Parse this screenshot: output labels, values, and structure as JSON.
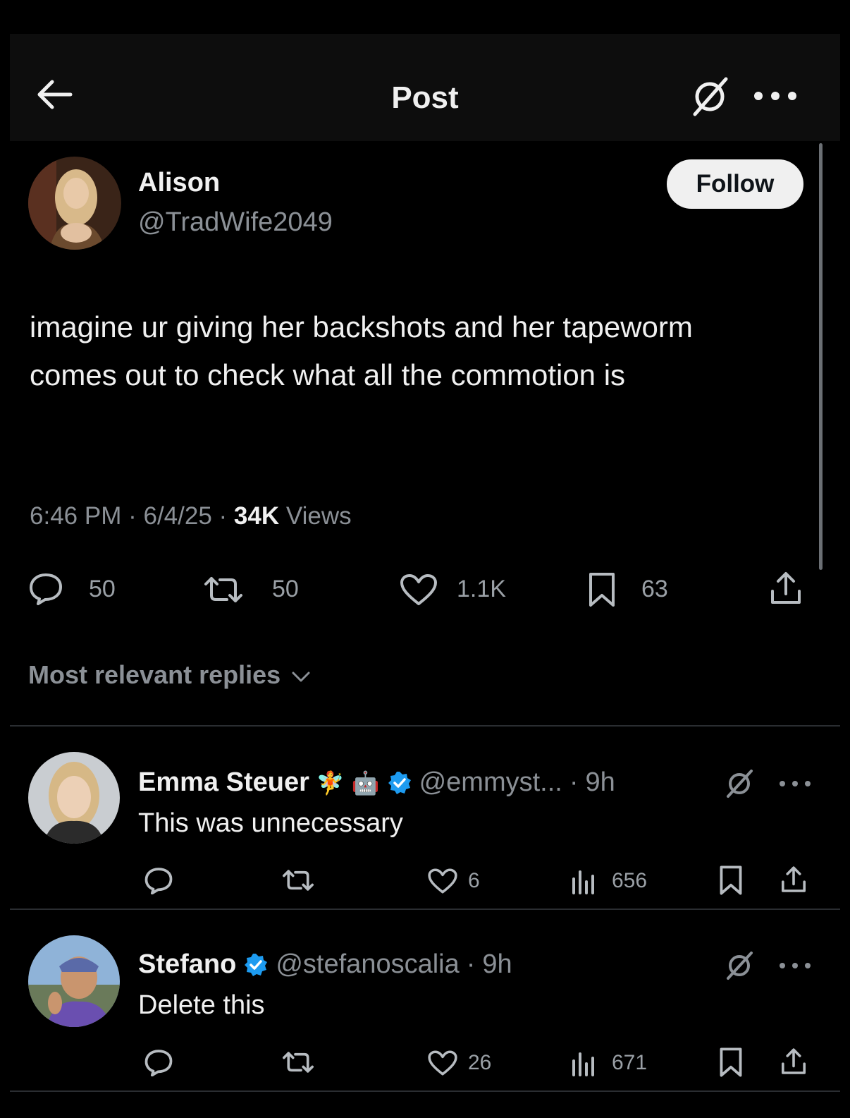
{
  "header": {
    "title": "Post",
    "back_icon": "arrow-left-icon",
    "grok_icon": "grok-icon",
    "more_icon": "more-horizontal-icon"
  },
  "post": {
    "author_name": "Alison",
    "author_handle": "@TradWife2049",
    "follow_label": "Follow",
    "text": "imagine ur giving her backshots and her tapeworm comes out to check what all the commotion is",
    "time": "6:46 PM",
    "date": "6/4/25",
    "views_count": "34K",
    "views_label": "Views",
    "separator": "·",
    "stats": {
      "replies": "50",
      "reposts": "50",
      "likes": "1.1K",
      "bookmarks": "63"
    }
  },
  "replies_sort": {
    "label": "Most relevant replies"
  },
  "replies": [
    {
      "name": "Emma Steuer",
      "badges": [
        "🧚",
        "🤖"
      ],
      "verified": true,
      "handle": "@emmyst...",
      "time": "9h",
      "text": "This was unnecessary",
      "likes": "6",
      "views": "656"
    },
    {
      "name": "Stefano",
      "verified": true,
      "handle": "@stefanoscalia",
      "time": "9h",
      "text": "Delete this",
      "likes": "26",
      "views": "671"
    }
  ],
  "colors": {
    "background": "#000000",
    "header_bg": "#0d0d0d",
    "text": "#f0f0f0",
    "muted": "#8b9096",
    "verified_blue": "#1d9bf0",
    "follow_bg": "#f0f0f0"
  }
}
